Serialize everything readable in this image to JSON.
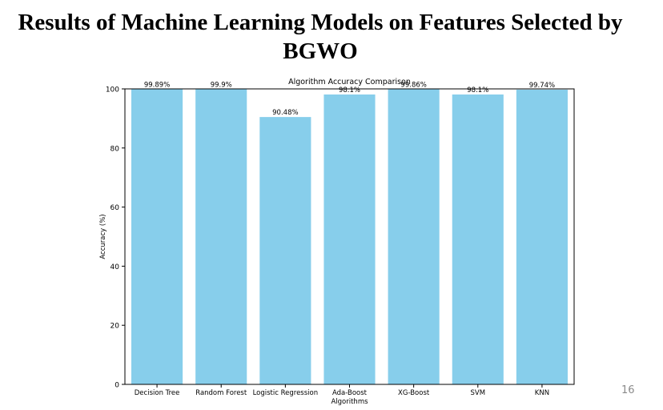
{
  "slide": {
    "title": "Results of Machine Learning Models on Features Selected by BGWO",
    "page_number": "16"
  },
  "chart_data": {
    "type": "bar",
    "title": "Algorithm Accuracy Comparison",
    "xlabel": "Algorithms",
    "ylabel": "Accuracy (%)",
    "ylim": [
      0,
      100
    ],
    "yticks": [
      0,
      20,
      40,
      60,
      80,
      100
    ],
    "categories": [
      "Decision Tree",
      "Random Forest",
      "Logistic Regression",
      "Ada-Boost",
      "XG-Boost",
      "SVM",
      "KNN"
    ],
    "values": [
      99.89,
      99.9,
      90.48,
      98.1,
      99.86,
      98.1,
      99.74
    ],
    "data_labels": [
      "99.89%",
      "99.9%",
      "90.48%",
      "98.1%",
      "99.86%",
      "98.1%",
      "99.74%"
    ],
    "bar_color": "#87ceeb",
    "grid": false,
    "legend": "none"
  }
}
